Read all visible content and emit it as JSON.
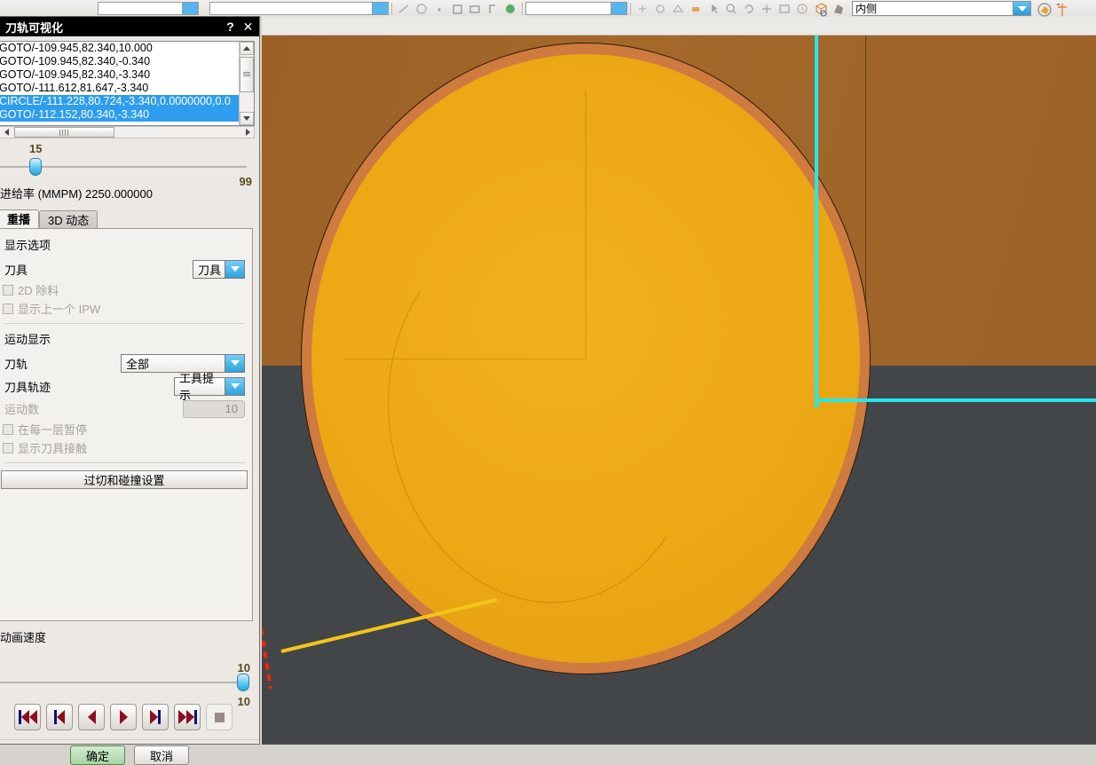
{
  "app_toolbar": {
    "right_combo_value": "内侧",
    "icons": [
      "dropdown-field-1",
      "dropdown-field-2",
      "tool-icon-1",
      "tool-icon-2",
      "tool-icon-3",
      "tool-icon-4",
      "tool-icon-5",
      "tool-icon-6",
      "tool-icon-7",
      "measure-icon",
      "cube-icon",
      "clay-icon",
      "solid-icon",
      "axis-icon"
    ]
  },
  "dialog": {
    "title": "刀轨可视化",
    "help_btn": "?",
    "close_btn": "✕",
    "list": {
      "rows": [
        {
          "text": "GOTO/-109.945,82.340,10.000",
          "selected": false
        },
        {
          "text": "GOTO/-109.945,82.340,-0.340",
          "selected": false
        },
        {
          "text": "GOTO/-109.945,82.340,-3.340",
          "selected": false
        },
        {
          "text": "GOTO/-111.612,81.647,-3.340",
          "selected": false
        },
        {
          "text": "CIRCLE/-111.228,80.724,-3.340,0.0000000,0.0",
          "selected": true
        },
        {
          "text": "GOTO/-112.152,80.340,-3.340",
          "selected": true
        }
      ]
    },
    "slider_step": {
      "value": "15",
      "max": "99"
    },
    "feed_rate_label": "进给率 (MMPM) 2250.000000",
    "tabs": [
      {
        "label": "重播",
        "active": true
      },
      {
        "label": "3D 动态",
        "active": false
      }
    ],
    "display_options": {
      "title": "显示选项",
      "tool_label": "刀具",
      "tool_value": "刀具",
      "checkbox_2d": "2D 除料",
      "checkbox_ipw": "显示上一个 IPW"
    },
    "motion_display": {
      "title": "运动显示",
      "toolpath_label": "刀轨",
      "toolpath_value": "全部",
      "trace_label": "刀具轨迹",
      "trace_value": "工具提示",
      "motion_count_label": "运动数",
      "motion_count_value": "10",
      "pause_each_layer": "在每一层暂停",
      "show_tool_contact": "显示刀具接触"
    },
    "collision_button": "过切和碰撞设置",
    "animation": {
      "title": "动画速度",
      "value_top": "10",
      "value_bottom": "10"
    },
    "playback": [
      {
        "name": "rewind-to-start-button"
      },
      {
        "name": "step-back-block-button"
      },
      {
        "name": "play-reverse-button"
      },
      {
        "name": "play-forward-button"
      },
      {
        "name": "step-forward-block-button"
      },
      {
        "name": "fast-forward-end-button"
      },
      {
        "name": "stop-button"
      }
    ],
    "footer": {
      "ok": "确定",
      "cancel": "取消"
    }
  },
  "viewport": {
    "stock_color": "#a4682a",
    "floor_color": "#434649",
    "tool_face_color": "#eeaa16",
    "tool_rim_color": "#cf7a3f",
    "toolpath_color": "#24e8ec",
    "feed_move_color": "#f5c518",
    "rapid_move_color": "#ff2200"
  }
}
